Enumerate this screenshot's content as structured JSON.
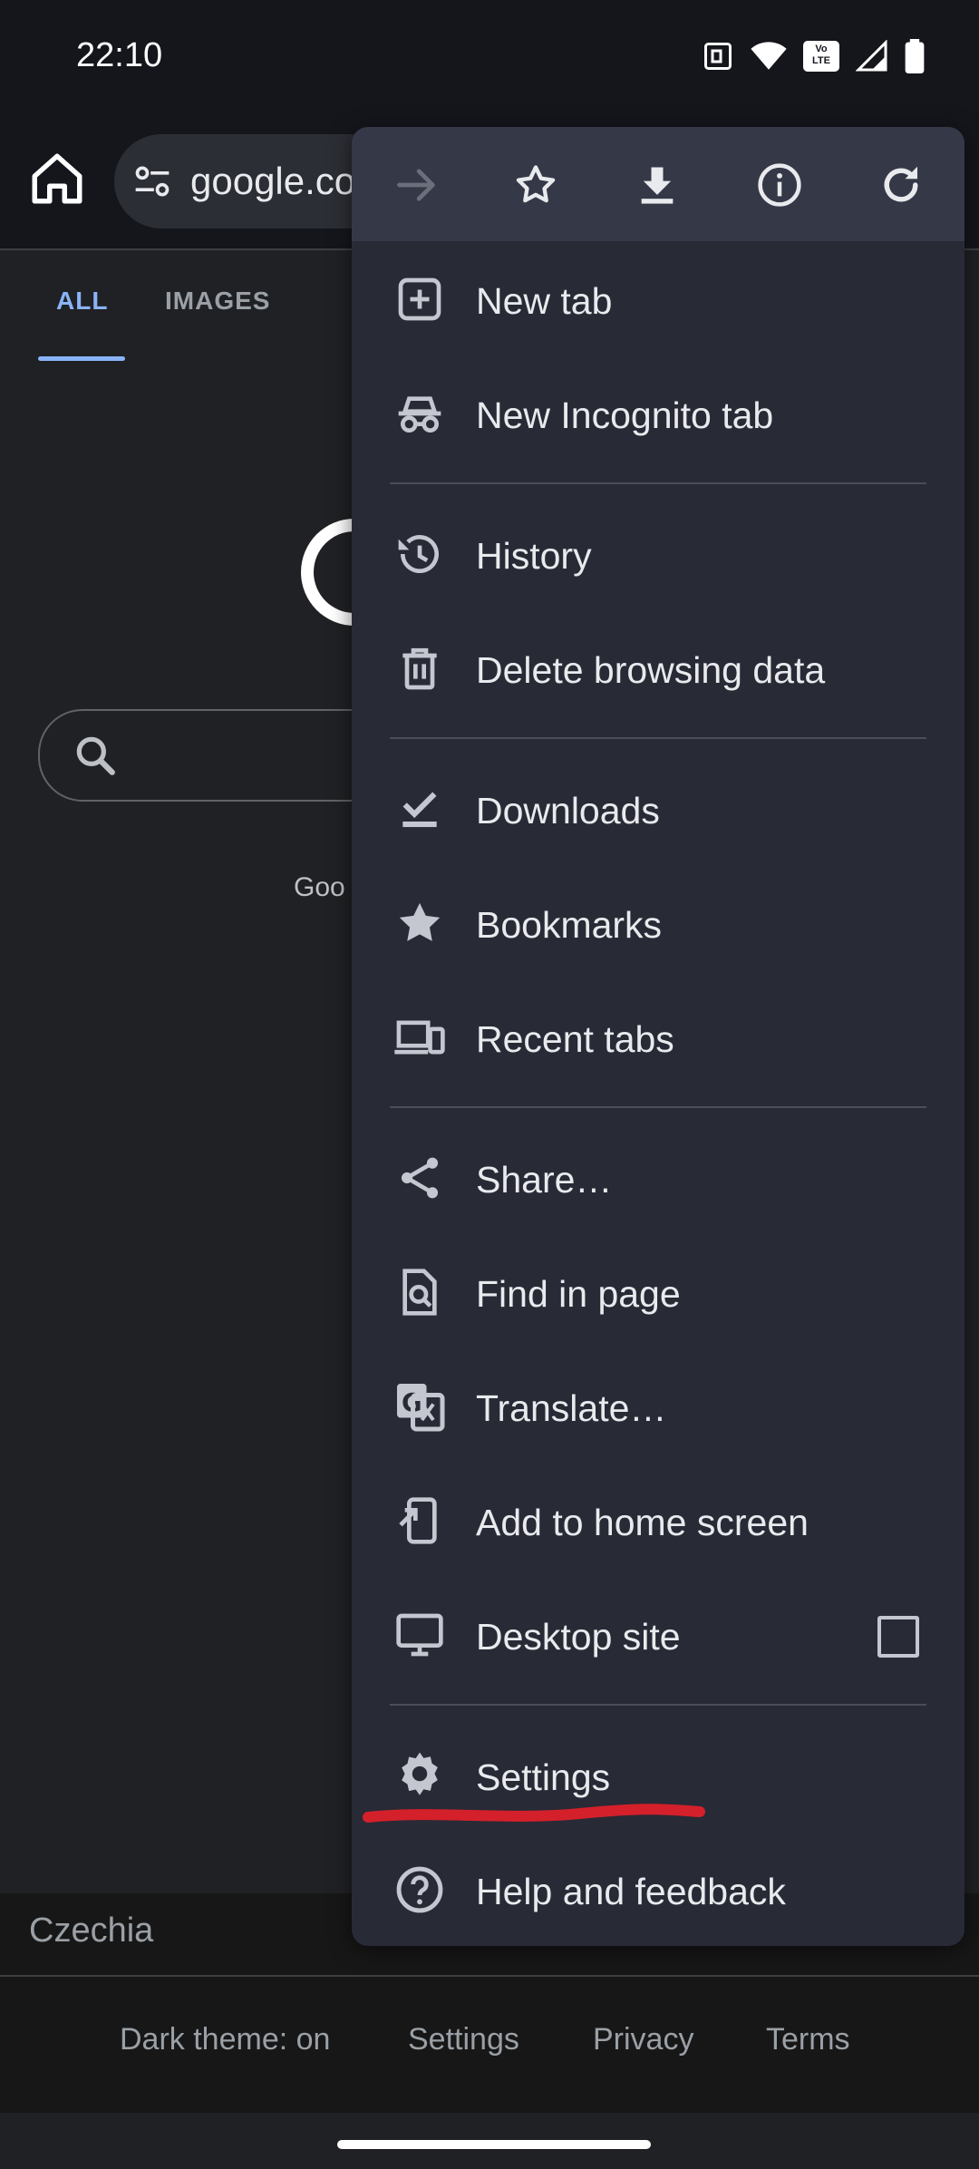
{
  "status_bar": {
    "time": "22:10",
    "icons": [
      "nfc-icon",
      "wifi-icon",
      "volte-icon",
      "signal-icon",
      "battery-icon"
    ],
    "volte_label": "Vo LTE"
  },
  "toolbar": {
    "url": "google.co",
    "home_icon": "home-icon",
    "site_settings_icon": "tune-icon"
  },
  "page": {
    "tabs": [
      {
        "label": "ALL",
        "active": true
      },
      {
        "label": "IMAGES",
        "active": false
      }
    ],
    "partial_text": "Goo",
    "region": "Czechia",
    "footer_links": [
      "Dark theme: on",
      "Settings",
      "Privacy",
      "Terms"
    ]
  },
  "menu": {
    "top_icons": [
      "forward-icon",
      "bookmark-star-icon",
      "download-icon",
      "info-icon",
      "refresh-icon"
    ],
    "items": [
      {
        "label": "New tab",
        "icon": "new-tab-icon"
      },
      {
        "label": "New Incognito tab",
        "icon": "incognito-icon"
      },
      {
        "label": "History",
        "icon": "history-icon"
      },
      {
        "label": "Delete browsing data",
        "icon": "trash-icon"
      },
      {
        "label": "Downloads",
        "icon": "downloads-icon"
      },
      {
        "label": "Bookmarks",
        "icon": "bookmarks-star-icon"
      },
      {
        "label": "Recent tabs",
        "icon": "devices-icon"
      },
      {
        "label": "Share…",
        "icon": "share-icon"
      },
      {
        "label": "Find in page",
        "icon": "find-in-page-icon"
      },
      {
        "label": "Translate…",
        "icon": "translate-icon"
      },
      {
        "label": "Add to home screen",
        "icon": "add-to-home-icon"
      },
      {
        "label": "Desktop site",
        "icon": "desktop-icon",
        "checked": false
      },
      {
        "label": "Settings",
        "icon": "gear-icon"
      },
      {
        "label": "Help and feedback",
        "icon": "help-icon"
      }
    ]
  },
  "colors": {
    "menu_bg": "#282a36",
    "menu_top_bg": "#353847",
    "accent": "#8ab4f8",
    "annotation": "#d4202a"
  }
}
